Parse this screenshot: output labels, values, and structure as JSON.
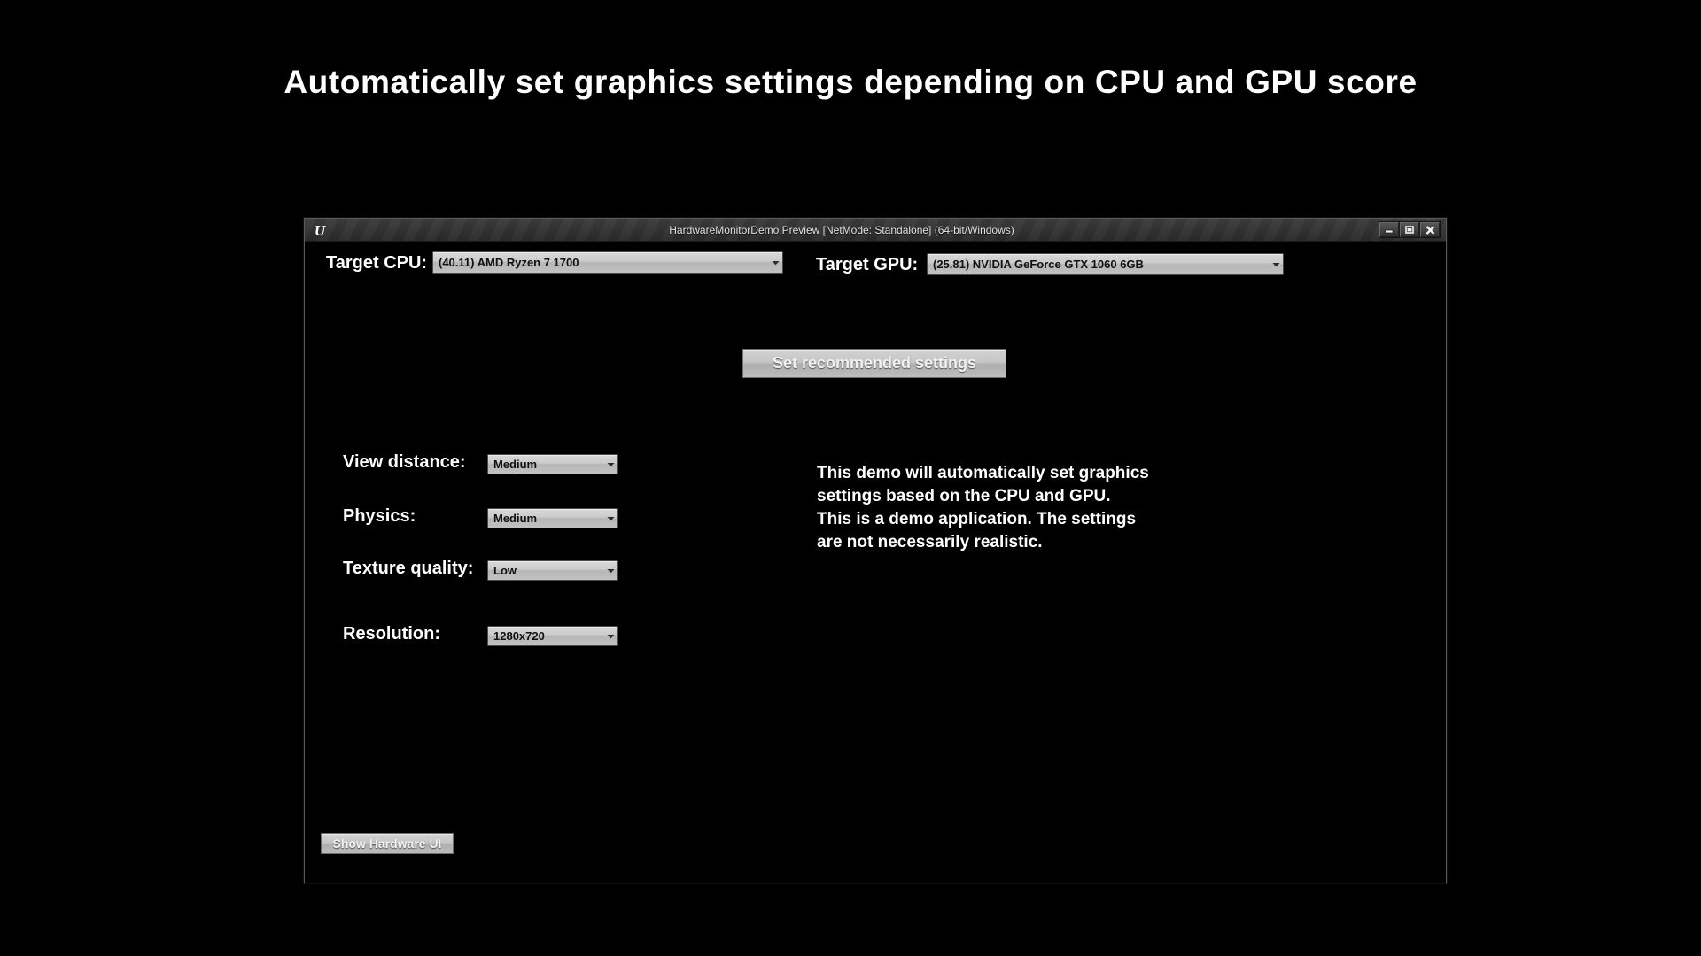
{
  "page": {
    "heading": "Automatically set graphics settings depending on CPU and GPU score",
    "background_color": "#000000",
    "heading_color": "#ffffff"
  },
  "window": {
    "title": "HardwareMonitorDemo Preview [NetMode: Standalone]  (64-bit/Windows)",
    "app_icon": "unreal-engine-logo",
    "controls": {
      "minimize": "minimize-icon",
      "maximize": "maximize-icon",
      "close": "close-icon"
    },
    "frame_color": "#5a5a5a",
    "titlebar_color": "#343434",
    "client_background": "#000000"
  },
  "hardware": {
    "cpu_label": "Target CPU:",
    "cpu_value": "(40.11) AMD Ryzen 7 1700",
    "cpu_options": [
      "(40.11) AMD Ryzen 7 1700"
    ],
    "gpu_label": "Target GPU:",
    "gpu_value": "(25.81) NVIDIA GeForce GTX 1060 6GB",
    "gpu_options": [
      "(25.81) NVIDIA GeForce GTX 1060 6GB"
    ]
  },
  "actions": {
    "set_recommended_settings": "Set recommended settings",
    "show_hardware_ui": "Show Hardware UI"
  },
  "settings": [
    {
      "label": "View distance:",
      "value": "Medium"
    },
    {
      "label": "Physics:",
      "value": "Medium"
    },
    {
      "label": "Texture quality:",
      "value": "Low"
    },
    {
      "label": "Resolution:",
      "value": "1280x720"
    }
  ],
  "description": "This demo will automatically set graphics settings based on the CPU and GPU. This is a demo application. The settings are not necessarily realistic."
}
